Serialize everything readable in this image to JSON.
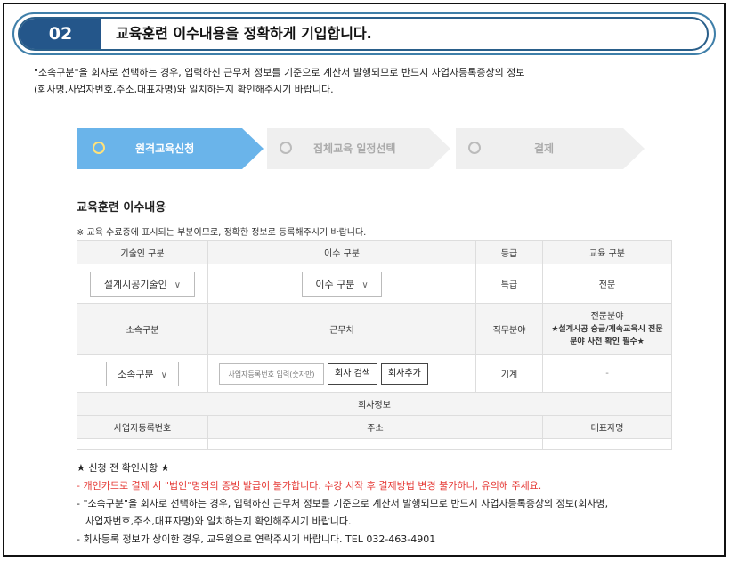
{
  "header": {
    "step_number": "02",
    "title": "교육훈련 이수내용을 정확하게 기입합니다."
  },
  "intro": {
    "line1": "\"소속구분\"을 회사로 선택하는 경우, 입력하신 근무처 정보를 기준으로 계산서 발행되므로 반드시 사업자등록증상의 정보",
    "line2": "(회사명,사업자번호,주소,대표자명)와 일치하는지 확인해주시기 바랍니다."
  },
  "steps": [
    {
      "label": "원격교육신청",
      "active": true
    },
    {
      "label": "집체교육 일정선택",
      "active": false
    },
    {
      "label": "결제",
      "active": false
    }
  ],
  "colors": {
    "active_step": "#6ab4ea",
    "inactive_step": "#efefef",
    "header_blue": "#24568a",
    "warning_red": "#e53935"
  },
  "section": {
    "title": "교육훈련 이수내용",
    "notice": "※ 교육 수료증에 표시되는 부분이므로, 정확한 정보로 등록해주시기 바랍니다."
  },
  "table": {
    "row1_headers": [
      "기술인 구분",
      "이수 구분",
      "등급",
      "교육 구분"
    ],
    "technician_select": "설계시공기술인",
    "completion_select": "이수 구분",
    "grade": "특급",
    "education_type": "전문",
    "row2_headers": {
      "affiliation": "소속구분",
      "workplace": "근무처",
      "duty_field": "직무분야",
      "specialty_line1": "전문분야",
      "specialty_line2": "★설계시공 승급/계속교육시 전문",
      "specialty_line3": "분야 사전 확인 필수★"
    },
    "affiliation_select": "소속구분",
    "business_input_placeholder": "사업자등록번호 입력(숫자만)",
    "company_search_button": "회사 검색",
    "add_company_button": "회사추가",
    "duty_field_value": "기계",
    "specialty_value": "-",
    "company_info_header": "회사정보",
    "row4_headers": [
      "사업자등록번호",
      "주소",
      "대표자명"
    ]
  },
  "confirm": {
    "title": "★ 신청 전 확인사항 ★",
    "item1": "- 개인카드로 결제 시 \"법인\"명의의 증빙 발급이 불가합니다. 수강 시작 후 결제방법 변경 불가하니, 유의해 주세요.",
    "item2a": "- \"소속구분\"을 회사로 선택하는 경우, 입력하신 근무처 정보를 기준으로 계산서 발행되므로 반드시 사업자등록증상의 정보(회사명,",
    "item2b": "사업자번호,주소,대표자명)와 일치하는지 확인해주시기 바랍니다.",
    "item3": "- 회사등록 정보가 상이한 경우, 교육원으로 연락주시기 바랍니다. TEL 032-463-4901"
  }
}
